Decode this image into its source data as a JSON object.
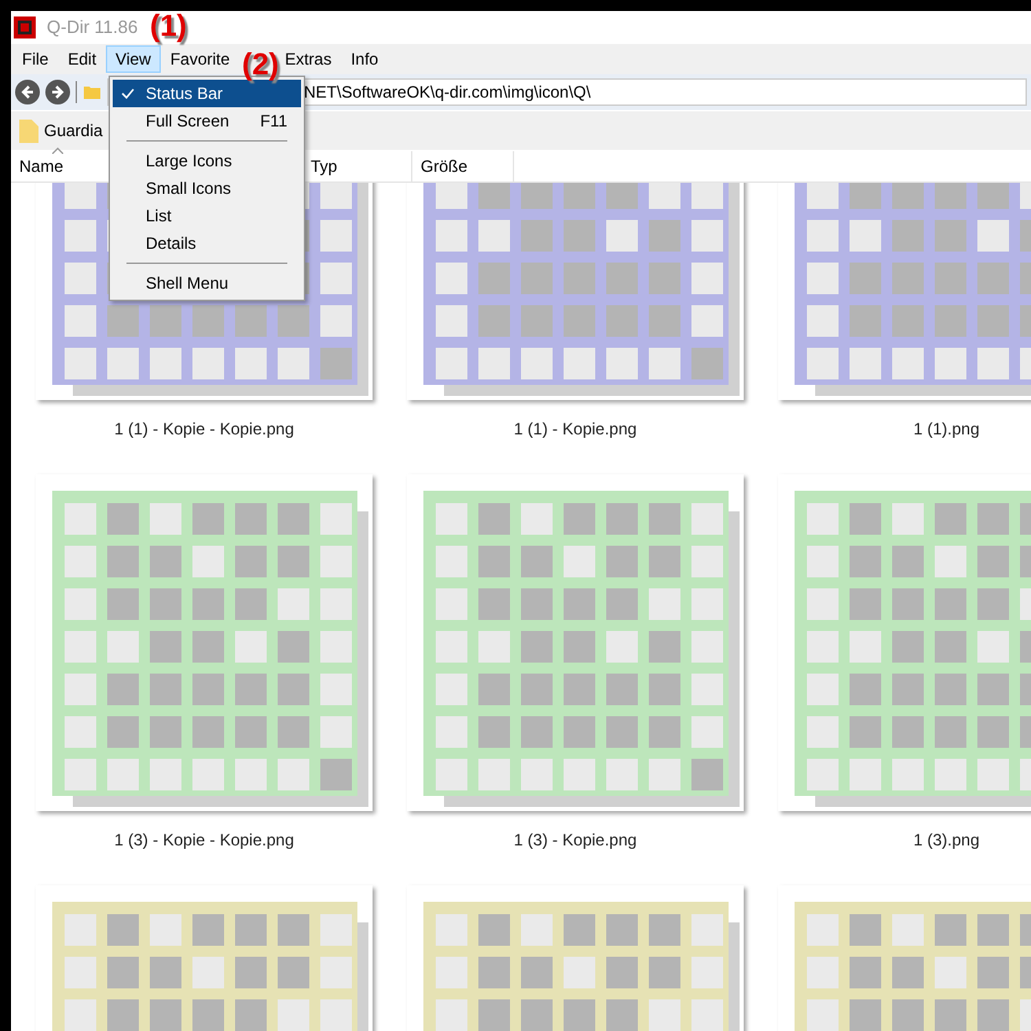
{
  "window": {
    "title": "Q-Dir 11.86"
  },
  "annotations": [
    {
      "label": "(1)"
    },
    {
      "label": "(2)"
    }
  ],
  "menu_bar": [
    {
      "label": "File",
      "selected": false
    },
    {
      "label": "Edit",
      "selected": false
    },
    {
      "label": "View",
      "selected": true
    },
    {
      "label": "Favorite",
      "selected": false
    },
    {
      "label": "Extras",
      "selected": false
    },
    {
      "label": "Info",
      "selected": false
    }
  ],
  "view_menu": [
    {
      "kind": "item",
      "label": "Status Bar",
      "checked": true,
      "selected": true
    },
    {
      "kind": "item",
      "label": "Full Screen",
      "shortcut": "F11",
      "checked": false,
      "selected": false
    },
    {
      "kind": "separator"
    },
    {
      "kind": "item",
      "label": "Large Icons",
      "checked": false,
      "selected": false
    },
    {
      "kind": "item",
      "label": "Small Icons",
      "checked": false,
      "selected": false
    },
    {
      "kind": "item",
      "label": "List",
      "checked": false,
      "selected": false
    },
    {
      "kind": "item",
      "label": "Details",
      "checked": false,
      "selected": false
    },
    {
      "kind": "separator"
    },
    {
      "kind": "item",
      "label": "Shell Menu",
      "checked": false,
      "selected": false
    }
  ],
  "address": {
    "value": "NET\\SoftwareOK\\q-dir.com\\img\\icon\\Q\\"
  },
  "favorites": [
    {
      "label": "Guardia"
    }
  ],
  "columns": [
    {
      "label": "Name",
      "sorted": true
    },
    {
      "label": "Typ",
      "sorted": false
    },
    {
      "label": "Größe",
      "sorted": false
    }
  ],
  "files": [
    {
      "name": "1 (1) - Kopie - Kopie.png",
      "color": "#b4b4e6"
    },
    {
      "name": "1 (1) - Kopie.png",
      "color": "#b4b4e6"
    },
    {
      "name": "1 (1).png",
      "color": "#b4b4e6"
    },
    {
      "name": "1 (3) - Kopie - Kopie.png",
      "color": "#bde6bb"
    },
    {
      "name": "1 (3) - Kopie.png",
      "color": "#bde6bb"
    },
    {
      "name": "1 (3).png",
      "color": "#bde6bb"
    },
    {
      "color": "#e6e2b4"
    },
    {
      "color": "#e6e2b4"
    },
    {
      "color": "#e6e2b4"
    }
  ]
}
